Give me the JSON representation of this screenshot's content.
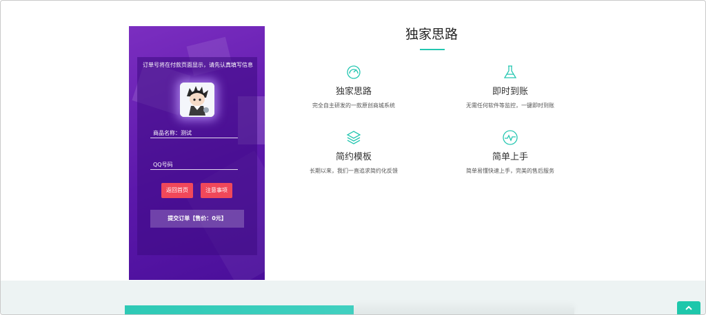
{
  "order_panel": {
    "notice": "订单号将在付款页面显示，请先认真填写信息",
    "product_field": "商品名称：测试",
    "qq_field_placeholder": "QQ号码",
    "back_button": "返回首页",
    "notes_button": "注意事项",
    "submit_button": "提交订单【售价：0元】"
  },
  "section": {
    "title": "独家思路"
  },
  "features": [
    {
      "icon": "speedometer-icon",
      "name": "独家思路",
      "desc": "完全自主研发的一款原创商城系统"
    },
    {
      "icon": "flask-icon",
      "name": "即时到账",
      "desc": "无需任何软件等监控，一键即时到账"
    },
    {
      "icon": "layers-icon",
      "name": "简约模板",
      "desc": "长期以来，我们一直追求简约化反馈"
    },
    {
      "icon": "pulse-icon",
      "name": "简单上手",
      "desc": "简单易懂快速上手，完美的售后服务"
    }
  ],
  "colors": {
    "accent": "#23c6b0",
    "panel_purple": "#5c18ab",
    "button_red": "#f0485a",
    "scroll_top": "#1ec7ab"
  },
  "scroll_top_icon": "chevron-up-icon"
}
